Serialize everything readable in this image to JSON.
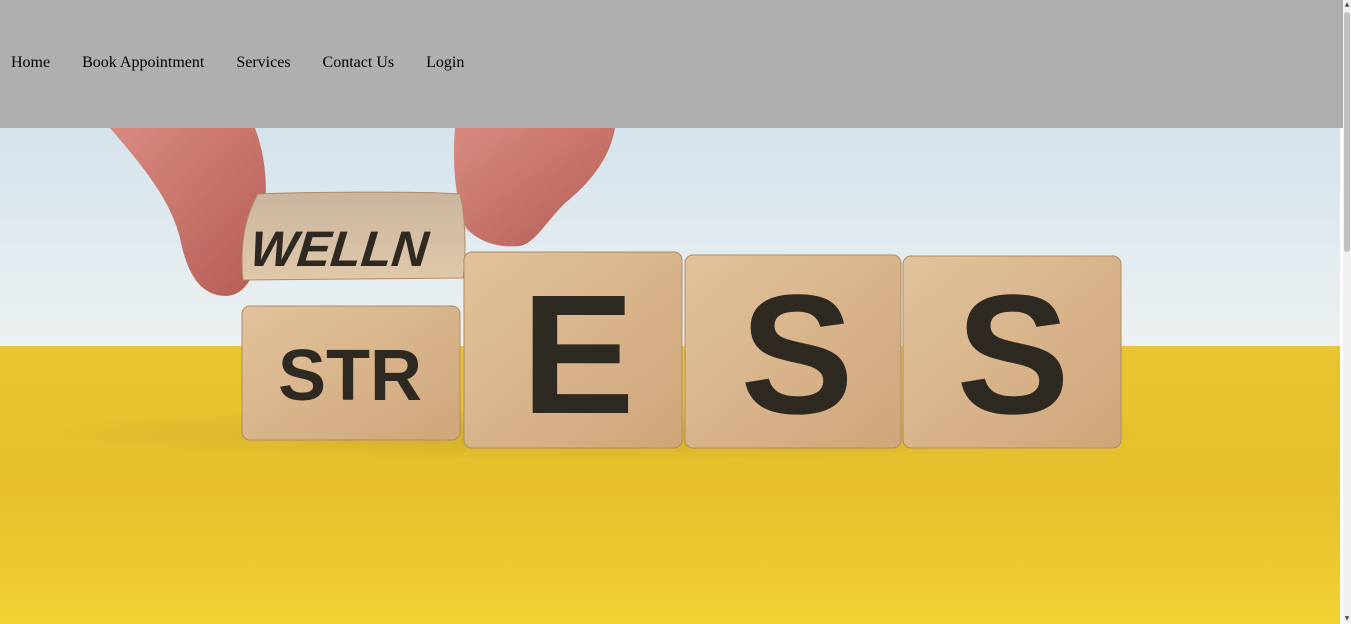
{
  "nav": {
    "items": [
      {
        "label": "Home"
      },
      {
        "label": "Book Appointment"
      },
      {
        "label": "Services"
      },
      {
        "label": "Contact Us"
      },
      {
        "label": "Login"
      }
    ]
  },
  "hero": {
    "cube_top_text": "WELLN",
    "cube_texts": [
      "STR",
      "E",
      "S",
      "S"
    ]
  },
  "colors": {
    "navbar_bg": "#afafaf",
    "table_yellow": "#e9c52a",
    "backdrop": "#dde8ee",
    "wood": "#d9b58a"
  }
}
